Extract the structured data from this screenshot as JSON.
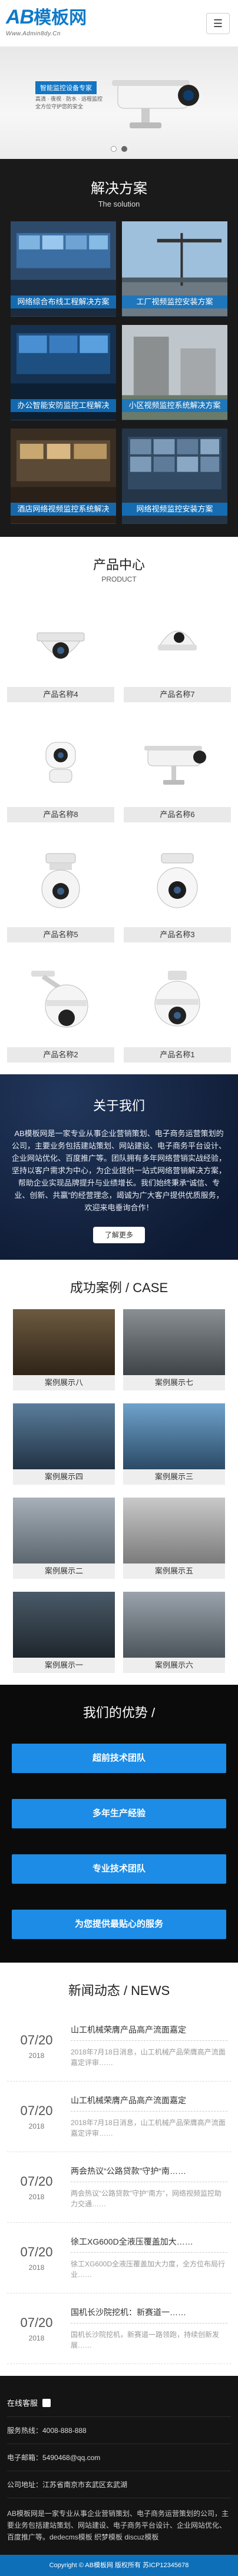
{
  "header": {
    "logo_ab": "AB",
    "logo_cn": "模板网",
    "logo_url": "Www.Admin8dy.Cn",
    "menu_icon": "menu-icon"
  },
  "banner": {
    "tagline": "智能监控设备专家",
    "subtitle": "高清 · 夜视 · 防水 · 远程监控 全方位守护您的安全",
    "slide_count": 2,
    "active_slide": 1
  },
  "solutions": {
    "title": "解决方案",
    "subtitle": "The solution",
    "items": [
      {
        "label": "网络综合布线工程解决方案"
      },
      {
        "label": "工厂视频监控安装方案"
      },
      {
        "label": "办公智能安防监控工程解决"
      },
      {
        "label": "小区视频监控系统解决方案"
      },
      {
        "label": "酒店网络视频监控系统解决"
      },
      {
        "label": "网络视频监控安装方案"
      }
    ]
  },
  "products": {
    "title": "产品中心",
    "subtitle": "PRODUCT",
    "items": [
      {
        "label": "产品名称4",
        "kind": "dome"
      },
      {
        "label": "产品名称7",
        "kind": "dome-small"
      },
      {
        "label": "产品名称8",
        "kind": "wifi"
      },
      {
        "label": "产品名称6",
        "kind": "bullet"
      },
      {
        "label": "产品名称5",
        "kind": "ptz"
      },
      {
        "label": "产品名称3",
        "kind": "ptz"
      },
      {
        "label": "产品名称2",
        "kind": "speed-dome"
      },
      {
        "label": "产品名称1",
        "kind": "speed-dome"
      }
    ]
  },
  "about": {
    "title": "关于我们",
    "text": "AB模板网是一家专业从事企业营销策划、电子商务运营策划的公司，主要业务包括建站策划、网站建设、电子商务平台设计、企业网站优化、百度推广等。团队拥有多年网络营销实战经验，坚持以客户需求为中心，为企业提供一站式网络营销解决方案，帮助企业实现品牌提升与业绩增长。我们始终秉承“诚信、专业、创新、共赢”的经营理念，竭诚为广大客户提供优质服务，欢迎来电垂询合作！",
    "more_label": "了解更多"
  },
  "cases": {
    "title": "成功案例 / CASE",
    "items": [
      {
        "label": "案例展示八"
      },
      {
        "label": "案例展示七"
      },
      {
        "label": "案例展示四"
      },
      {
        "label": "案例展示三"
      },
      {
        "label": "案例展示二"
      },
      {
        "label": "案例展示五"
      },
      {
        "label": "案例展示一"
      },
      {
        "label": "案例展示六"
      }
    ]
  },
  "advantage": {
    "title": "我们的优势 /",
    "items": [
      {
        "label": "超前技术团队"
      },
      {
        "label": "多年生产经验"
      },
      {
        "label": "专业技术团队"
      },
      {
        "label": "为您提供最贴心的服务"
      }
    ]
  },
  "news": {
    "title": "新闻动态 / NEWS",
    "items": [
      {
        "md": "07/20",
        "yr": "2018",
        "title": "山工机械荣膺产品高产流面嘉定",
        "desc": "2018年7月18日消息，山工机械产品荣膺高产流面嘉定评审……"
      },
      {
        "md": "07/20",
        "yr": "2018",
        "title": "山工机械荣膺产品高产流面嘉定",
        "desc": "2018年7月18日消息，山工机械产品荣膺高产流面嘉定评审……"
      },
      {
        "md": "07/20",
        "yr": "2018",
        "title": "两会热议“公路贷款”守护“南……",
        "desc": "两会热议“公路贷款”守护“南方”，网络视频监控助力交通……"
      },
      {
        "md": "07/20",
        "yr": "2018",
        "title": "徐工XG600D全液压覆盖加大……",
        "desc": "徐工XG600D全液压覆盖加大力度，全方位布局行业……"
      },
      {
        "md": "07/20",
        "yr": "2018",
        "title": "国机长沙院挖机：新赛道一……",
        "desc": "国机长沙院挖机，新赛道一路领跑，持续创新发展……"
      }
    ]
  },
  "contact": {
    "header": "在线客服",
    "phone": "服务热线：4008-888-888",
    "email": "电子邮箱：5490468@qq.com",
    "address": "公司地址：江苏省南京市玄武区玄武湖",
    "intro": "AB模板网是一家专业从事企业营销策划、电子商务运营策划的公司，主要业务包括建站策划、网站建设、电子商务平台设计、企业网站优化、百度推广等。dedecms模板 织梦模板 discuz模板",
    "footer": "Copyright © AB模板网 版权所有  苏ICP12345678"
  },
  "colors": {
    "brand": "#1376c4",
    "adv_button": "#1c8ce6",
    "dark_bg": "#1a1a1a"
  }
}
